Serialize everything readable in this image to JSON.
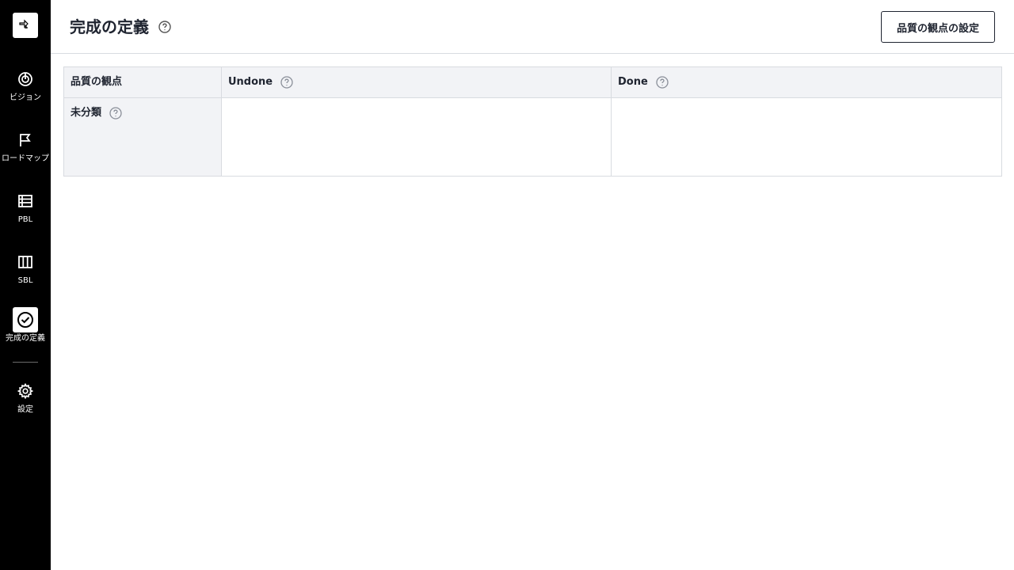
{
  "sidebar": {
    "logo_icon": "ship-logo-icon",
    "items": [
      {
        "label": "ビジョン",
        "icon": "target-icon",
        "active": false
      },
      {
        "label": "ロードマップ",
        "icon": "flag-icon",
        "active": false
      },
      {
        "label": "PBL",
        "icon": "list-icon",
        "active": false
      },
      {
        "label": "SBL",
        "icon": "columns-icon",
        "active": false
      },
      {
        "label": "完成の定義",
        "icon": "check-circle-icon",
        "active": true
      },
      {
        "label": "設定",
        "icon": "gear-icon",
        "active": false
      }
    ]
  },
  "header": {
    "title": "完成の定義",
    "settings_button": "品質の観点の設定"
  },
  "table": {
    "columns": [
      "品質の観点",
      "Undone",
      "Done"
    ],
    "rows": [
      {
        "label": "未分類",
        "undone": "",
        "done": ""
      }
    ]
  },
  "colors": {
    "sidebar_bg": "#000000",
    "header_bg": "#f2f3f6",
    "border": "#d8dbe0",
    "text": "#1f2430"
  }
}
